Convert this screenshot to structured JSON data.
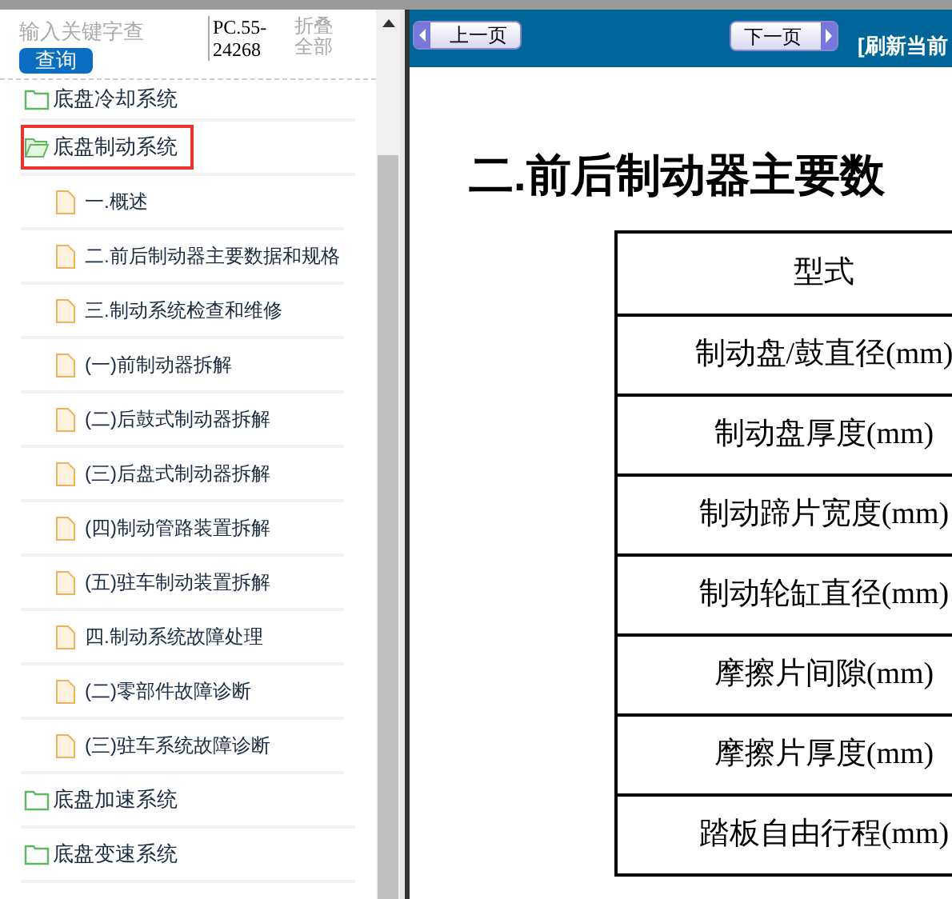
{
  "sidebar": {
    "search": {
      "placeholder": "输入关键字查"
    },
    "search_button": "查询",
    "code": "PC.55-24268",
    "collapse_link": "折叠全部",
    "tree": [
      {
        "label": "底盘冷却系统",
        "expanded": false,
        "selected": false
      },
      {
        "label": "底盘制动系统",
        "expanded": true,
        "selected": true,
        "children": [
          {
            "label": "一.概述"
          },
          {
            "label": "二.前后制动器主要数据和规格"
          },
          {
            "label": "三.制动系统检查和维修"
          },
          {
            "label": "(一)前制动器拆解"
          },
          {
            "label": "(二)后鼓式制动器拆解"
          },
          {
            "label": "(三)后盘式制动器拆解"
          },
          {
            "label": "(四)制动管路装置拆解"
          },
          {
            "label": "(五)驻车制动装置拆解"
          },
          {
            "label": "四.制动系统故障处理"
          },
          {
            "label": "(二)零部件故障诊断"
          },
          {
            "label": "(三)驻车系统故障诊断"
          }
        ]
      },
      {
        "label": "底盘加速系统",
        "expanded": false,
        "selected": false
      },
      {
        "label": "底盘变速系统",
        "expanded": false,
        "selected": false
      }
    ]
  },
  "toolbar": {
    "prev_button": "上一页",
    "next_button": "下一页",
    "refresh_link": "[刷新当前"
  },
  "document": {
    "title": "二.前后制动器主要数",
    "table_rows": [
      "型式",
      "制动盘/鼓直径(mm)",
      "制动盘厚度(mm)",
      "制动蹄片宽度(mm)",
      "制动轮缸直径(mm)",
      "摩擦片间隙(mm)",
      "摩擦片厚度(mm)",
      "踏板自由行程(mm)"
    ]
  }
}
